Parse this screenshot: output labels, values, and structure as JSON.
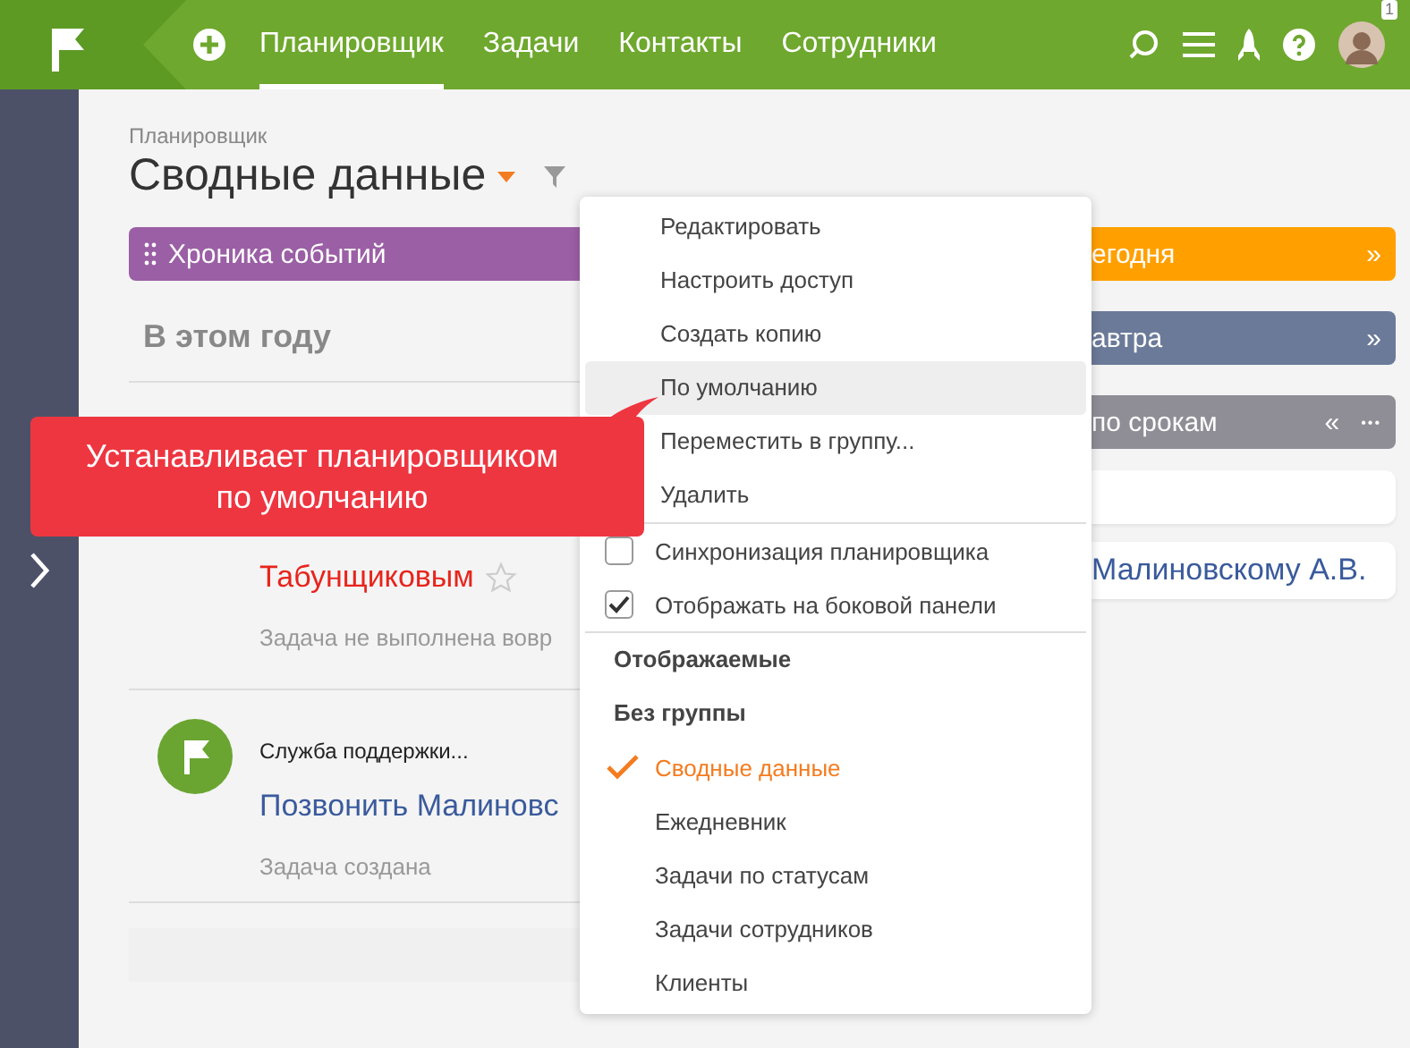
{
  "topbar": {
    "nav": [
      {
        "label": "Планировщик",
        "selected": true
      },
      {
        "label": "Задачи",
        "selected": false
      },
      {
        "label": "Контакты",
        "selected": false
      },
      {
        "label": "Сотрудники",
        "selected": false
      }
    ],
    "notification_count": "1"
  },
  "header": {
    "breadcrumb": "Планировщик",
    "title": "Сводные данные"
  },
  "timeline": {
    "title": "Хроника событий",
    "period": "В этом году",
    "items": [
      {
        "kind": "task",
        "title": "Табунщиковым",
        "overdue": true,
        "status": "Задача не выполнена вовр"
      },
      {
        "kind": "support",
        "author": "Служба поддержки...",
        "title": "Позвонить Малиновс",
        "overdue": false,
        "status": "Задача создана"
      }
    ]
  },
  "right_columns": [
    {
      "title": "егодня",
      "color": "#ffa000",
      "control": "»"
    },
    {
      "title": "автра",
      "color": "#6b7a99",
      "control": "»"
    },
    {
      "title": "по срокам",
      "color": "#8f8e96",
      "control": "«",
      "more": "•••",
      "cards": [
        {
          "kind": "empty"
        },
        {
          "kind": "task",
          "title": "Малиновскому А.В."
        }
      ]
    }
  ],
  "menu": [
    {
      "kind": "action",
      "label": "Редактировать",
      "highlighted": false
    },
    {
      "kind": "action",
      "label": "Настроить доступ",
      "highlighted": false
    },
    {
      "kind": "action",
      "label": "Создать копию",
      "highlighted": false
    },
    {
      "kind": "action",
      "label": "По умолчанию",
      "highlighted": true
    },
    {
      "kind": "action",
      "label": "Переместить в группу...",
      "highlighted": false
    },
    {
      "kind": "action",
      "label": "Удалить",
      "highlighted": false
    },
    {
      "kind": "divider"
    },
    {
      "kind": "checkbox",
      "label": "Синхронизация планировщика",
      "checked": false
    },
    {
      "kind": "checkbox",
      "label": "Отображать на боковой панели",
      "checked": true
    },
    {
      "kind": "divider"
    },
    {
      "kind": "header",
      "label": "Отображаемые"
    },
    {
      "kind": "header",
      "label": "Без группы"
    },
    {
      "kind": "option",
      "label": "Сводные данные",
      "selected": true
    },
    {
      "kind": "option",
      "label": "Ежедневник",
      "selected": false
    },
    {
      "kind": "option",
      "label": "Задачи по статусам",
      "selected": false
    },
    {
      "kind": "option",
      "label": "Задачи сотрудников",
      "selected": false
    },
    {
      "kind": "option",
      "label": "Клиенты",
      "selected": false
    }
  ],
  "tooltip": {
    "text": "Устанавливает планировщиком по умолчанию"
  }
}
